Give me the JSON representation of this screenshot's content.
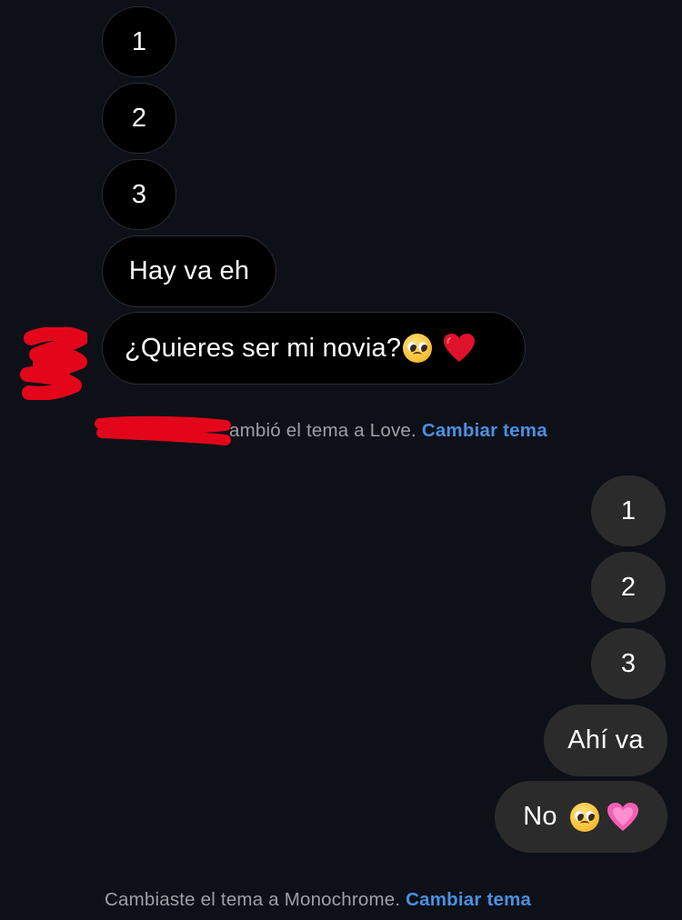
{
  "received": {
    "msg1": "1",
    "msg2": "2",
    "msg3": "3",
    "msg4": "Hay va eh",
    "msg5": "¿Quieres ser mi novia?"
  },
  "notice_top": {
    "text": "ambió el tema a Love.",
    "link": "Cambiar tema"
  },
  "sent": {
    "msg1": "1",
    "msg2": "2",
    "msg3": "3",
    "msg4": "Ahí va",
    "msg5": "No"
  },
  "notice_bottom": {
    "text": "Cambiaste el tema a Monochrome.",
    "link": "Cambiar tema"
  },
  "icons": {
    "pleading_face": "pleading-face-emoji",
    "red_heart": "red-heart-emoji",
    "pink_heart": "growing-pink-heart-emoji"
  },
  "colors": {
    "background": "#0d1017",
    "received_bubble": "#000000",
    "sent_bubble": "#2b2b2b",
    "link": "#4a90e2",
    "redaction": "#e3061b"
  }
}
